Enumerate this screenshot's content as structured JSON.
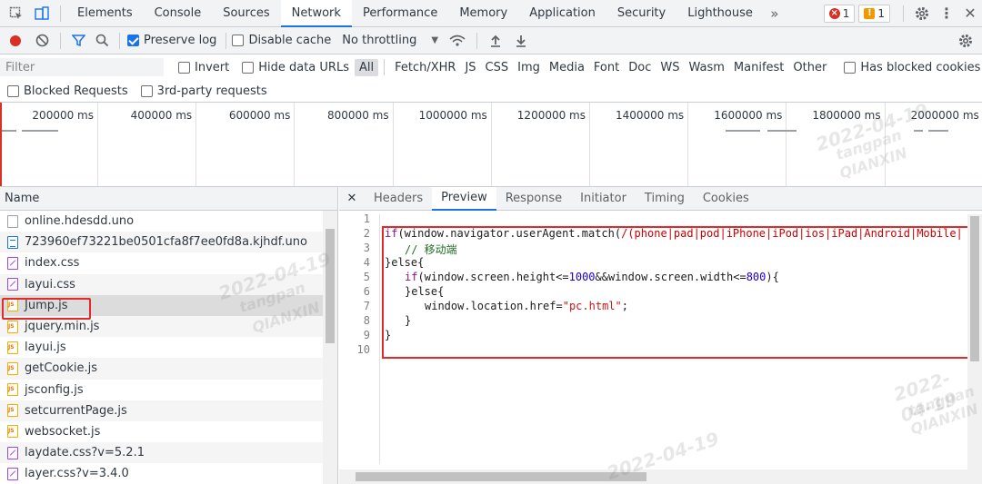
{
  "top_tabs": [
    "Elements",
    "Console",
    "Sources",
    "Network",
    "Performance",
    "Memory",
    "Application",
    "Security",
    "Lighthouse"
  ],
  "active_tab": "Network",
  "more_tabs_icon": "chevron-double-right-icon",
  "errors_count": "1",
  "warnings_count": "1",
  "toolbar": {
    "preserve_log": "Preserve log",
    "disable_cache": "Disable cache",
    "throttling": "No throttling"
  },
  "filter": {
    "placeholder": "Filter",
    "invert": "Invert",
    "hide_data_urls": "Hide data URLs",
    "types": [
      "All",
      "Fetch/XHR",
      "JS",
      "CSS",
      "Img",
      "Media",
      "Font",
      "Doc",
      "WS",
      "Wasm",
      "Manifest",
      "Other"
    ],
    "has_blocked_cookies": "Has blocked cookies",
    "blocked_requests": "Blocked Requests",
    "third_party": "3rd-party requests"
  },
  "overview": {
    "labels": [
      "200000 ms",
      "400000 ms",
      "600000 ms",
      "800000 ms",
      "1000000 ms",
      "1200000 ms",
      "1400000 ms",
      "1600000 ms",
      "1800000 ms",
      "2000000 ms"
    ]
  },
  "requests": {
    "header": "Name",
    "files": [
      {
        "name": "online.hdesdd.uno",
        "type": "plain"
      },
      {
        "name": "723960ef73221be0501cfa8f7ee0fd8a.kjhdf.uno",
        "type": "doc"
      },
      {
        "name": "index.css",
        "type": "css"
      },
      {
        "name": "layui.css",
        "type": "css"
      },
      {
        "name": "Jump.js",
        "type": "js"
      },
      {
        "name": "jquery.min.js",
        "type": "js"
      },
      {
        "name": "layui.js",
        "type": "js"
      },
      {
        "name": "getCookie.js",
        "type": "js"
      },
      {
        "name": "jsconfig.js",
        "type": "js"
      },
      {
        "name": "setcurrentPage.js",
        "type": "js"
      },
      {
        "name": "websocket.js",
        "type": "js"
      },
      {
        "name": "laydate.css?v=5.2.1",
        "type": "css"
      },
      {
        "name": "layer.css?v=3.4.0",
        "type": "css"
      }
    ]
  },
  "detail_tabs": [
    "Headers",
    "Preview",
    "Response",
    "Initiator",
    "Timing",
    "Cookies"
  ],
  "active_detail_tab": "Preview",
  "code": {
    "line_numbers": [
      "1",
      "2",
      "3",
      "4",
      "5",
      "6",
      "7",
      "8",
      "9",
      "10"
    ],
    "l2_kw": "if",
    "l2_a": "(window.navigator.userAgent.match(",
    "l2_rx": "/(phone|pad|pod|iPhone|iPod|ios|iPad|Android|Mobile|",
    "l3_cm": "// 移动端",
    "l4": "}else{",
    "l5_kw": "if",
    "l5_a": "(window.screen.height<=",
    "l5_n1": "1000",
    "l5_b": "&&window.screen.width<=",
    "l5_n2": "800",
    "l5_c": "){",
    "l6": "}else{",
    "l7_a": "window.location.href=",
    "l7_s": "\"pc.html\"",
    "l7_b": ";",
    "l8": "}",
    "l9": "}"
  },
  "watermark": {
    "date": "2022-04-19",
    "user": "tangpan",
    "org": "QIANXIN"
  }
}
